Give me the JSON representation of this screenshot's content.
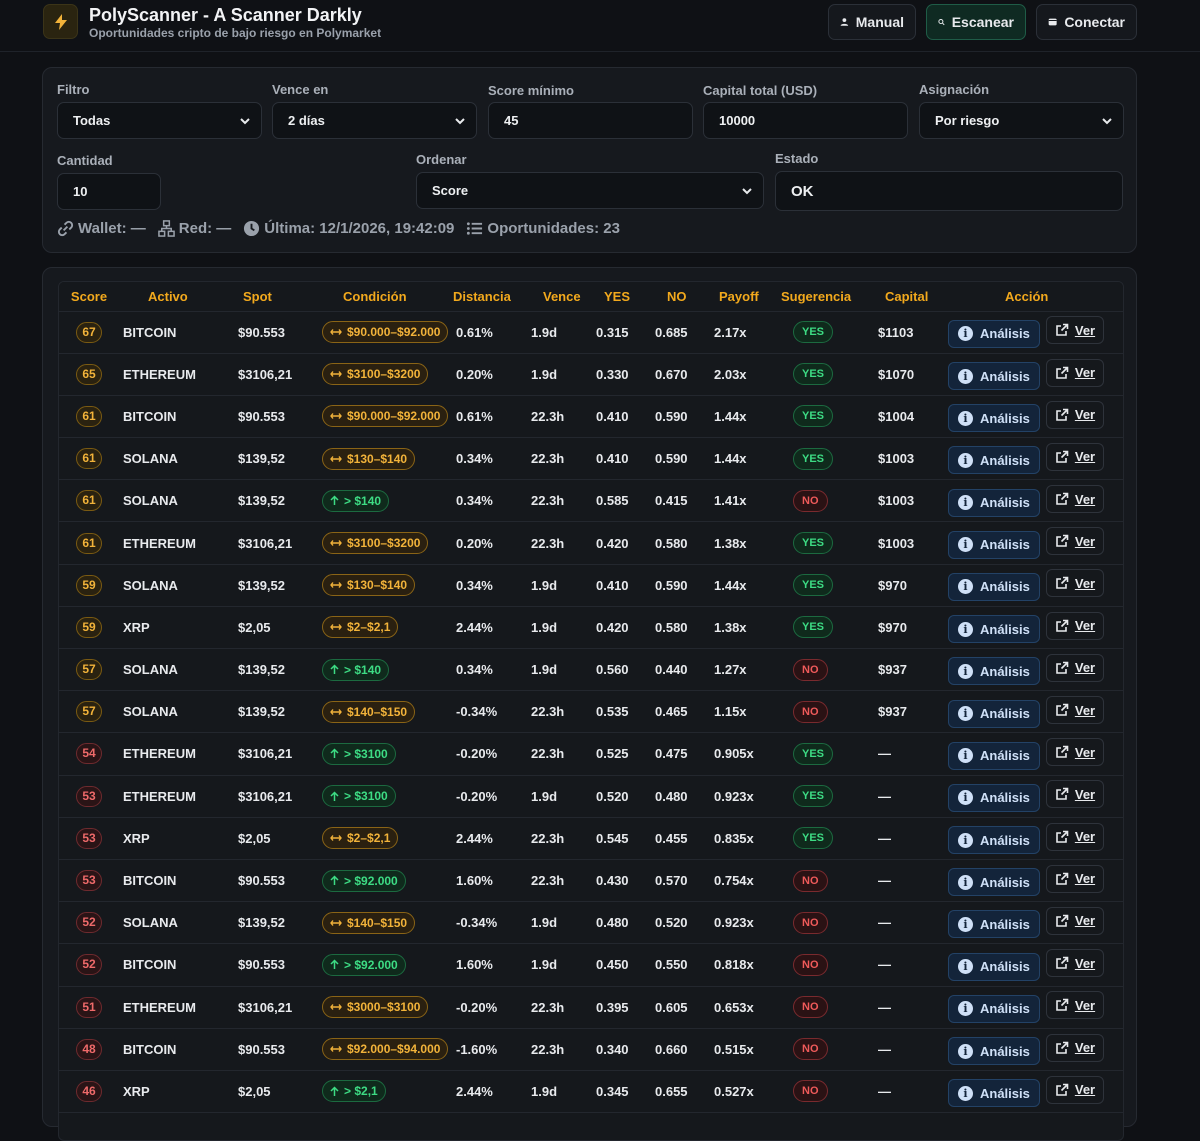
{
  "header": {
    "title": "PolyScanner - A Scanner Darkly",
    "subtitle": "Oportunidades cripto de bajo riesgo en Polymarket",
    "manual_label": "Manual",
    "scan_label": "Escanear",
    "connect_label": "Conectar",
    "logo_icon": "lightning-icon",
    "logo_color": "#f2b33a"
  },
  "filters": {
    "filtro": {
      "label": "Filtro",
      "value": "Todas"
    },
    "vence": {
      "label": "Vence en",
      "value": "2 días"
    },
    "score_min": {
      "label": "Score mínimo",
      "value": "45"
    },
    "capital": {
      "label": "Capital total (USD)",
      "value": "10000"
    },
    "asignacion": {
      "label": "Asignación",
      "value": "Por riesgo"
    },
    "cantidad": {
      "label": "Cantidad",
      "value": "10"
    },
    "ordenar": {
      "label": "Ordenar",
      "value": "Score"
    },
    "estado": {
      "label": "Estado",
      "value": "OK"
    }
  },
  "meta": {
    "wallet": "Wallet: —",
    "red": "Red: —",
    "ultima": "Última: 12/1/2026, 19:42:09",
    "oportunidades": "Oportunidades: 23"
  },
  "table": {
    "headers": [
      "Score",
      "Activo",
      "Spot",
      "Condición",
      "Distancia",
      "Vence",
      "YES",
      "NO",
      "Payoff",
      "Sugerencia",
      "Capital",
      "Acción"
    ],
    "analisis_label": "Análisis",
    "ver_label": "Ver",
    "colors": {
      "amber": "#f2b33a",
      "green": "#3ddc84",
      "red": "#ef5a5a"
    },
    "rows": [
      {
        "score": "67",
        "tone": "amber",
        "activo": "BITCOIN",
        "spot": "$90.553",
        "cond": "$90.000–$92.000",
        "ctype": "range",
        "dist": "0.61%",
        "vence": "1.9d",
        "yes": "0.315",
        "no": "0.685",
        "payoff": "2.17x",
        "sug": "YES",
        "capital": "$1103"
      },
      {
        "score": "65",
        "tone": "amber",
        "activo": "ETHEREUM",
        "spot": "$3106,21",
        "cond": "$3100–$3200",
        "ctype": "range",
        "dist": "0.20%",
        "vence": "1.9d",
        "yes": "0.330",
        "no": "0.670",
        "payoff": "2.03x",
        "sug": "YES",
        "capital": "$1070"
      },
      {
        "score": "61",
        "tone": "amber",
        "activo": "BITCOIN",
        "spot": "$90.553",
        "cond": "$90.000–$92.000",
        "ctype": "range",
        "dist": "0.61%",
        "vence": "22.3h",
        "yes": "0.410",
        "no": "0.590",
        "payoff": "1.44x",
        "sug": "YES",
        "capital": "$1004"
      },
      {
        "score": "61",
        "tone": "amber",
        "activo": "SOLANA",
        "spot": "$139,52",
        "cond": "$130–$140",
        "ctype": "range",
        "dist": "0.34%",
        "vence": "22.3h",
        "yes": "0.410",
        "no": "0.590",
        "payoff": "1.44x",
        "sug": "YES",
        "capital": "$1003"
      },
      {
        "score": "61",
        "tone": "amber",
        "activo": "SOLANA",
        "spot": "$139,52",
        "cond": "> $140",
        "ctype": "above",
        "dist": "0.34%",
        "vence": "22.3h",
        "yes": "0.585",
        "no": "0.415",
        "payoff": "1.41x",
        "sug": "NO",
        "capital": "$1003"
      },
      {
        "score": "61",
        "tone": "amber",
        "activo": "ETHEREUM",
        "spot": "$3106,21",
        "cond": "$3100–$3200",
        "ctype": "range",
        "dist": "0.20%",
        "vence": "22.3h",
        "yes": "0.420",
        "no": "0.580",
        "payoff": "1.38x",
        "sug": "YES",
        "capital": "$1003"
      },
      {
        "score": "59",
        "tone": "amber",
        "activo": "SOLANA",
        "spot": "$139,52",
        "cond": "$130–$140",
        "ctype": "range",
        "dist": "0.34%",
        "vence": "1.9d",
        "yes": "0.410",
        "no": "0.590",
        "payoff": "1.44x",
        "sug": "YES",
        "capital": "$970"
      },
      {
        "score": "59",
        "tone": "amber",
        "activo": "XRP",
        "spot": "$2,05",
        "cond": "$2–$2,1",
        "ctype": "range",
        "dist": "2.44%",
        "vence": "1.9d",
        "yes": "0.420",
        "no": "0.580",
        "payoff": "1.38x",
        "sug": "YES",
        "capital": "$970"
      },
      {
        "score": "57",
        "tone": "amber",
        "activo": "SOLANA",
        "spot": "$139,52",
        "cond": "> $140",
        "ctype": "above",
        "dist": "0.34%",
        "vence": "1.9d",
        "yes": "0.560",
        "no": "0.440",
        "payoff": "1.27x",
        "sug": "NO",
        "capital": "$937"
      },
      {
        "score": "57",
        "tone": "amber",
        "activo": "SOLANA",
        "spot": "$139,52",
        "cond": "$140–$150",
        "ctype": "range",
        "dist": "-0.34%",
        "vence": "22.3h",
        "yes": "0.535",
        "no": "0.465",
        "payoff": "1.15x",
        "sug": "NO",
        "capital": "$937"
      },
      {
        "score": "54",
        "tone": "red",
        "activo": "ETHEREUM",
        "spot": "$3106,21",
        "cond": "> $3100",
        "ctype": "above",
        "dist": "-0.20%",
        "vence": "22.3h",
        "yes": "0.525",
        "no": "0.475",
        "payoff": "0.905x",
        "sug": "YES",
        "capital": "—"
      },
      {
        "score": "53",
        "tone": "red",
        "activo": "ETHEREUM",
        "spot": "$3106,21",
        "cond": "> $3100",
        "ctype": "above",
        "dist": "-0.20%",
        "vence": "1.9d",
        "yes": "0.520",
        "no": "0.480",
        "payoff": "0.923x",
        "sug": "YES",
        "capital": "—"
      },
      {
        "score": "53",
        "tone": "red",
        "activo": "XRP",
        "spot": "$2,05",
        "cond": "$2–$2,1",
        "ctype": "range",
        "dist": "2.44%",
        "vence": "22.3h",
        "yes": "0.545",
        "no": "0.455",
        "payoff": "0.835x",
        "sug": "YES",
        "capital": "—"
      },
      {
        "score": "53",
        "tone": "red",
        "activo": "BITCOIN",
        "spot": "$90.553",
        "cond": "> $92.000",
        "ctype": "above",
        "dist": "1.60%",
        "vence": "22.3h",
        "yes": "0.430",
        "no": "0.570",
        "payoff": "0.754x",
        "sug": "NO",
        "capital": "—"
      },
      {
        "score": "52",
        "tone": "red",
        "activo": "SOLANA",
        "spot": "$139,52",
        "cond": "$140–$150",
        "ctype": "range",
        "dist": "-0.34%",
        "vence": "1.9d",
        "yes": "0.480",
        "no": "0.520",
        "payoff": "0.923x",
        "sug": "NO",
        "capital": "—"
      },
      {
        "score": "52",
        "tone": "red",
        "activo": "BITCOIN",
        "spot": "$90.553",
        "cond": "> $92.000",
        "ctype": "above",
        "dist": "1.60%",
        "vence": "1.9d",
        "yes": "0.450",
        "no": "0.550",
        "payoff": "0.818x",
        "sug": "NO",
        "capital": "—"
      },
      {
        "score": "51",
        "tone": "red",
        "activo": "ETHEREUM",
        "spot": "$3106,21",
        "cond": "$3000–$3100",
        "ctype": "range",
        "dist": "-0.20%",
        "vence": "22.3h",
        "yes": "0.395",
        "no": "0.605",
        "payoff": "0.653x",
        "sug": "NO",
        "capital": "—"
      },
      {
        "score": "48",
        "tone": "red",
        "activo": "BITCOIN",
        "spot": "$90.553",
        "cond": "$92.000–$94.000",
        "ctype": "range",
        "dist": "-1.60%",
        "vence": "22.3h",
        "yes": "0.340",
        "no": "0.660",
        "payoff": "0.515x",
        "sug": "NO",
        "capital": "—"
      },
      {
        "score": "46",
        "tone": "red",
        "activo": "XRP",
        "spot": "$2,05",
        "cond": "> $2,1",
        "ctype": "above",
        "dist": "2.44%",
        "vence": "1.9d",
        "yes": "0.345",
        "no": "0.655",
        "payoff": "0.527x",
        "sug": "NO",
        "capital": "—"
      }
    ]
  }
}
